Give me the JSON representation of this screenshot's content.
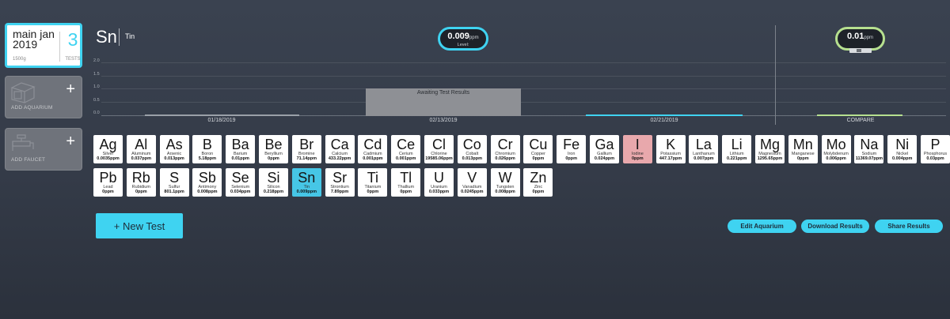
{
  "sidebar": {
    "aquarium": {
      "name": "main jan 2019",
      "volume": "1500g",
      "tests_count": "3",
      "tests_label": "TESTS"
    },
    "add_aquarium": {
      "label": "ADD AQUARIUM",
      "plus": "+"
    },
    "add_faucet": {
      "label": "ADD FAUCET",
      "plus": "+"
    }
  },
  "header": {
    "symbol": "Sn",
    "name": "Tin",
    "level_pill": {
      "value": "0.009",
      "unit": "ppm",
      "label": "Level:"
    },
    "compare_pill": {
      "value": "0.01",
      "unit": "ppm"
    }
  },
  "chart_data": {
    "type": "bar",
    "categories": [
      "01/18/2019",
      "02/13/2019",
      "02/21/2019",
      "COMPARE"
    ],
    "ytick_labels": [
      "2.0",
      "1.5",
      "1.0",
      "0.5",
      "0.0"
    ],
    "ylim": [
      0,
      2.0
    ],
    "values": [
      0,
      1.0,
      0.009,
      0.01
    ],
    "annotation": "Awaiting Test Results",
    "colors": {
      "awaiting": "#8e9095",
      "test": "#3fd3f1",
      "compare": "#b6e08f",
      "baseline": "#9aa0a8"
    }
  },
  "elements_row1": [
    {
      "sym": "Ag",
      "name": "Silver",
      "val": "0.0035ppm"
    },
    {
      "sym": "Al",
      "name": "Aluminum",
      "val": "0.037ppm"
    },
    {
      "sym": "As",
      "name": "Arsenic",
      "val": "0.013ppm"
    },
    {
      "sym": "B",
      "name": "Boron",
      "val": "5.18ppm"
    },
    {
      "sym": "Ba",
      "name": "Barium",
      "val": "0.01ppm"
    },
    {
      "sym": "Be",
      "name": "Beryllium",
      "val": "0ppm"
    },
    {
      "sym": "Br",
      "name": "Bromine",
      "val": "71.14ppm"
    },
    {
      "sym": "Ca",
      "name": "Calcium",
      "val": "433.22ppm"
    },
    {
      "sym": "Cd",
      "name": "Cadmium",
      "val": "0.001ppm"
    },
    {
      "sym": "Ce",
      "name": "Cerium",
      "val": "0.001ppm"
    },
    {
      "sym": "Cl",
      "name": "Chlorine",
      "val": "19585.06ppm"
    },
    {
      "sym": "Co",
      "name": "Cobalt",
      "val": "0.013ppm"
    },
    {
      "sym": "Cr",
      "name": "Chromium",
      "val": "0.026ppm"
    },
    {
      "sym": "Cu",
      "name": "Copper",
      "val": "0ppm"
    },
    {
      "sym": "Fe",
      "name": "Iron",
      "val": "0ppm"
    },
    {
      "sym": "Ga",
      "name": "Gallium",
      "val": "0.024ppm"
    },
    {
      "sym": "I",
      "name": "Iodine",
      "val": "0ppm",
      "state": "highlight"
    },
    {
      "sym": "K",
      "name": "Potassium",
      "val": "447.17ppm"
    },
    {
      "sym": "La",
      "name": "Lanthanum",
      "val": "0.007ppm"
    },
    {
      "sym": "Li",
      "name": "Lithium",
      "val": "0.221ppm"
    },
    {
      "sym": "Mg",
      "name": "Magnesium",
      "val": "1295.65ppm"
    },
    {
      "sym": "Mn",
      "name": "Manganese",
      "val": "0ppm"
    },
    {
      "sym": "Mo",
      "name": "Molybdenum",
      "val": "0.006ppm"
    },
    {
      "sym": "Na",
      "name": "Sodium",
      "val": "11369.07ppm"
    },
    {
      "sym": "Ni",
      "name": "Nickel",
      "val": "0.004ppm"
    },
    {
      "sym": "P",
      "name": "Phosphorus",
      "val": "0.03ppm"
    }
  ],
  "elements_row2": [
    {
      "sym": "Pb",
      "name": "Lead",
      "val": "0ppm"
    },
    {
      "sym": "Rb",
      "name": "Rubidium",
      "val": "0ppm"
    },
    {
      "sym": "S",
      "name": "Sulfur",
      "val": "801.1ppm"
    },
    {
      "sym": "Sb",
      "name": "Antimony",
      "val": "0.008ppm"
    },
    {
      "sym": "Se",
      "name": "Selenium",
      "val": "0.034ppm"
    },
    {
      "sym": "Si",
      "name": "Silicon",
      "val": "0.218ppm"
    },
    {
      "sym": "Sn",
      "name": "Tin",
      "val": "0.009ppm",
      "state": "selected"
    },
    {
      "sym": "Sr",
      "name": "Strontium",
      "val": "7.89ppm"
    },
    {
      "sym": "Ti",
      "name": "Titanium",
      "val": "0ppm"
    },
    {
      "sym": "Tl",
      "name": "Thallium",
      "val": "0ppm"
    },
    {
      "sym": "U",
      "name": "Uranium",
      "val": "0.033ppm"
    },
    {
      "sym": "V",
      "name": "Vanadium",
      "val": "0.0245ppm"
    },
    {
      "sym": "W",
      "name": "Tungsten",
      "val": "0.008ppm"
    },
    {
      "sym": "Zn",
      "name": "Zinc",
      "val": "0ppm"
    }
  ],
  "actions": {
    "new_test": "+ New Test",
    "edit_aquarium": "Edit Aquarium",
    "download_results": "Download Results",
    "share_results": "Share Results"
  },
  "colors": {
    "accent": "#3fd3f1",
    "compare": "#b6e08f",
    "selected_tile": "#46c6e6",
    "highlight_tile": "#e8a8ac"
  }
}
